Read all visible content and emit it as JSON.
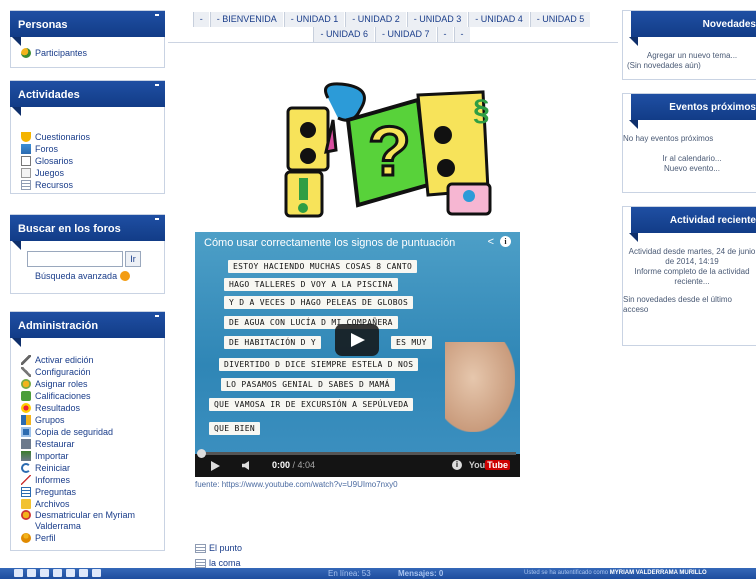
{
  "left": {
    "personas": {
      "title": "Personas",
      "items": [
        "Participantes"
      ]
    },
    "actividades": {
      "title": "Actividades",
      "items": [
        "Cuestionarios",
        "Foros",
        "Glosarios",
        "Juegos",
        "Recursos"
      ]
    },
    "buscar": {
      "title": "Buscar en los foros",
      "button": "Ir",
      "advanced": "Búsqueda avanzada",
      "query": ""
    },
    "admin": {
      "title": "Administración",
      "items": [
        "Activar edición",
        "Configuración",
        "Asignar roles",
        "Calificaciones",
        "Resultados",
        "Grupos",
        "Copia de seguridad",
        "Restaurar",
        "Importar",
        "Reiniciar",
        "Informes",
        "Preguntas",
        "Archivos",
        "Desmatricular en Myriam Valderrama",
        "Perfil"
      ]
    }
  },
  "tabs": [
    "-",
    "- BIENVENIDA",
    "- UNIDAD 1",
    "- UNIDAD 2",
    "- UNIDAD 3",
    "- UNIDAD 4",
    "- UNIDAD 5",
    "- UNIDAD 6",
    "- UNIDAD 7",
    "-",
    "-"
  ],
  "video": {
    "title": "Cómo usar correctamente los signos de puntuación",
    "current_time": "0:00",
    "duration": "/ 4:04",
    "brand": "You",
    "brand_tube": "Tube",
    "strips": [
      "ESTOY HACIENDO MUCHAS COSAS 8 CANTO",
      "HAGO TALLERES D VOY A LA PISCINA",
      "Y D A VECES D HAGO PELEAS DE GLOBOS",
      "DE AGUA CON LUCÍA D MI COMPAÑERA",
      "DE HABITACIÓN D Y",
      "ES MUY",
      "DIVERTIDO D DICE SIEMPRE ESTELA D NOS",
      "LO PASAMOS GENIAL D SABES D MAMÁ",
      "QUE VAMOSA IR DE EXCURSIÓN A SEPÚLVEDA",
      "QUE BIEN"
    ],
    "source": "fuente: https://www.youtube.com/watch?v=U9UImo7nxy0"
  },
  "resources": [
    "El punto",
    "la coma"
  ],
  "right": {
    "novedades": {
      "title": "Novedades",
      "link": "Agregar un nuevo tema...",
      "note": "(Sin novedades aún)"
    },
    "eventos": {
      "title": "Eventos próximos",
      "none": "No hay eventos próximos",
      "link1": "Ir al calendario...",
      "link2": "Nuevo evento..."
    },
    "actividad": {
      "title": "Actividad reciente",
      "since": "Actividad desde martes, 24 de junio de 2014, 14:19",
      "report": "Informe completo de la actividad reciente...",
      "none": "Sin novedades desde el último acceso"
    }
  },
  "footer": {
    "online": "En línea: 53",
    "messages": "Mensajes: 0",
    "auth_prefix": "Usted se ha autentificado como",
    "user": "MYRIAM VALDERRAMA MURILLO"
  },
  "colors": {
    "accent": "#1a4a9c",
    "link": "#1a3d8a"
  }
}
